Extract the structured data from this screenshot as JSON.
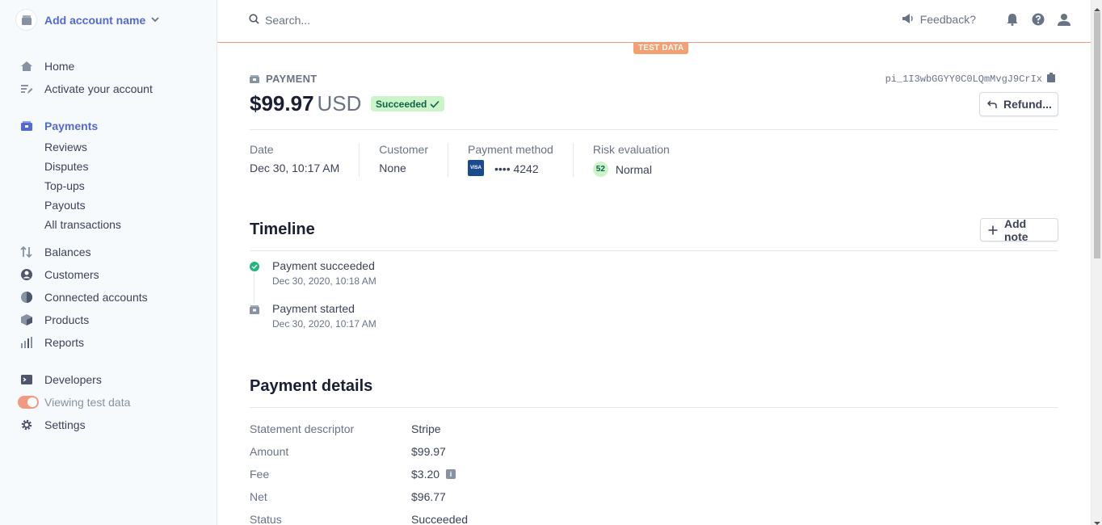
{
  "account": {
    "name": "Add account name"
  },
  "nav": {
    "home": "Home",
    "activate": "Activate your account",
    "payments": "Payments",
    "payments_sub": [
      "Reviews",
      "Disputes",
      "Top-ups",
      "Payouts",
      "All transactions"
    ],
    "balances": "Balances",
    "customers": "Customers",
    "connected": "Connected accounts",
    "products": "Products",
    "reports": "Reports",
    "developers": "Developers",
    "test_data": "Viewing test data",
    "settings": "Settings"
  },
  "topbar": {
    "search_placeholder": "Search...",
    "feedback": "Feedback?",
    "test_badge": "TEST DATA"
  },
  "payment": {
    "label": "PAYMENT",
    "id": "pi_1I3wbGGYY0C0LQmMvgJ9CrIx",
    "amount": "$99.97",
    "currency": "USD",
    "status": "Succeeded",
    "refund_label": "Refund..."
  },
  "summary": {
    "date_label": "Date",
    "date": "Dec 30, 10:17 AM",
    "customer_label": "Customer",
    "customer": "None",
    "method_label": "Payment method",
    "card_brand": "VISA",
    "card_last4": "•••• 4242",
    "risk_label": "Risk evaluation",
    "risk_score": "52",
    "risk_level": "Normal"
  },
  "timeline": {
    "title": "Timeline",
    "add_note": "Add note",
    "events": [
      {
        "title": "Payment succeeded",
        "time": "Dec 30, 2020, 10:18 AM"
      },
      {
        "title": "Payment started",
        "time": "Dec 30, 2020, 10:17 AM"
      }
    ]
  },
  "details": {
    "title": "Payment details",
    "rows": [
      {
        "key": "Statement descriptor",
        "value": "Stripe"
      },
      {
        "key": "Amount",
        "value": "$99.97"
      },
      {
        "key": "Fee",
        "value": "$3.20"
      },
      {
        "key": "Net",
        "value": "$96.77"
      },
      {
        "key": "Status",
        "value": "Succeeded"
      }
    ]
  },
  "colors": {
    "accent": "#5469d4",
    "test": "#f19a82",
    "success": "#0e6245"
  }
}
